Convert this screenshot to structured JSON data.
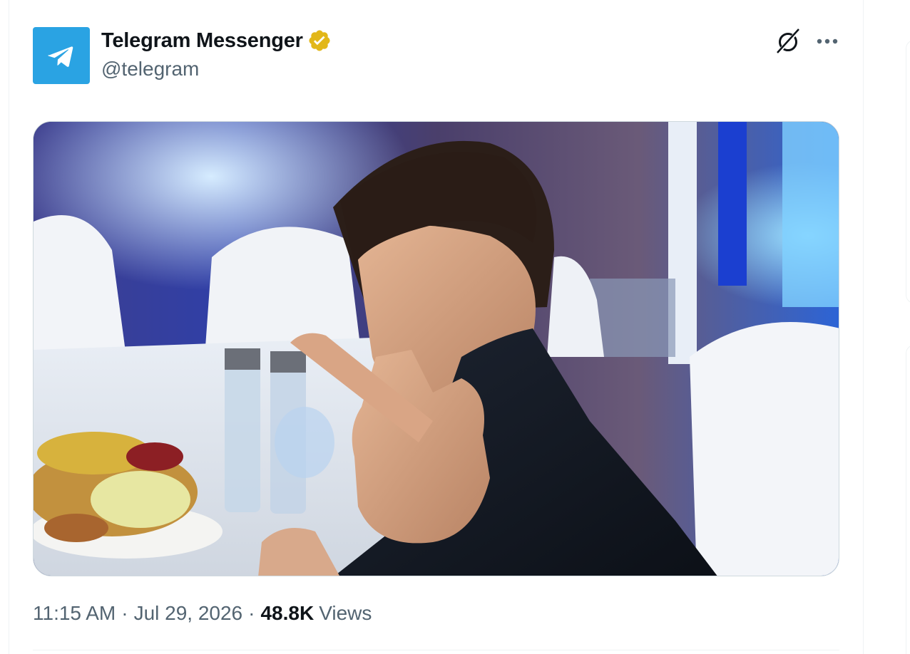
{
  "post": {
    "author": {
      "display_name": "Telegram Messenger",
      "handle": "@telegram",
      "verified": true,
      "avatar_icon": "telegram-paper-plane-icon",
      "avatar_color": "#2aa3e3",
      "verified_color": "#e2b719"
    },
    "actions": {
      "grok_icon": "grok-icon",
      "more_icon": "more-options-icon"
    },
    "media": {
      "type": "photo"
    },
    "meta": {
      "time": "11:15 AM",
      "separator": "·",
      "date": "Jul 29, 2026",
      "views_count": "48.8K",
      "views_label": "Views"
    }
  }
}
